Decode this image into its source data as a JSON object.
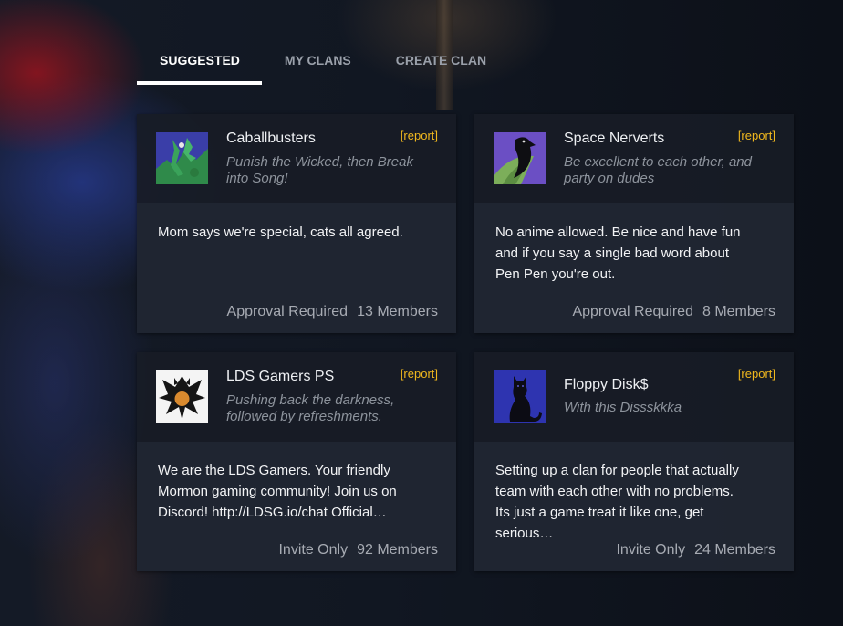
{
  "tabs": [
    {
      "label": "SUGGESTED",
      "active": true
    },
    {
      "label": "MY CLANS",
      "active": false
    },
    {
      "label": "CREATE CLAN",
      "active": false
    }
  ],
  "report_label": "[report]",
  "clans": [
    {
      "name": "Caballbusters",
      "motto": "Punish the Wicked, then Break into Song!",
      "description": "Mom says we're special, cats all agreed.",
      "join_type": "Approval Required",
      "members": "13 Members",
      "emblem": "dragon-emblem-icon"
    },
    {
      "name": "Space Nerverts",
      "motto": "Be excellent to each other, and party on dudes",
      "description": "No anime allowed. Be nice and have fun and if you say a single bad word about Pen Pen you're out.",
      "join_type": "Approval Required",
      "members": "8 Members",
      "emblem": "raven-emblem-icon"
    },
    {
      "name": "LDS Gamers PS",
      "motto": "Pushing back the darkness, followed by refreshments.",
      "description": "We are the LDS Gamers. Your friendly Mormon gaming community! Join us on Discord! http://LDSG.io/chat Official…",
      "join_type": "Invite Only",
      "members": "92 Members",
      "emblem": "eagle-emblem-icon"
    },
    {
      "name": "Floppy Disk$",
      "motto": "With this Dissskkka",
      "description": "Setting up a clan for people that actually team with each other with no problems. Its just a game treat it like one, get serious…",
      "join_type": "Invite Only",
      "members": "24 Members",
      "emblem": "cat-emblem-icon"
    }
  ],
  "colors": {
    "report": "#f0b81e",
    "active_tab_underline": "#ffffff"
  }
}
